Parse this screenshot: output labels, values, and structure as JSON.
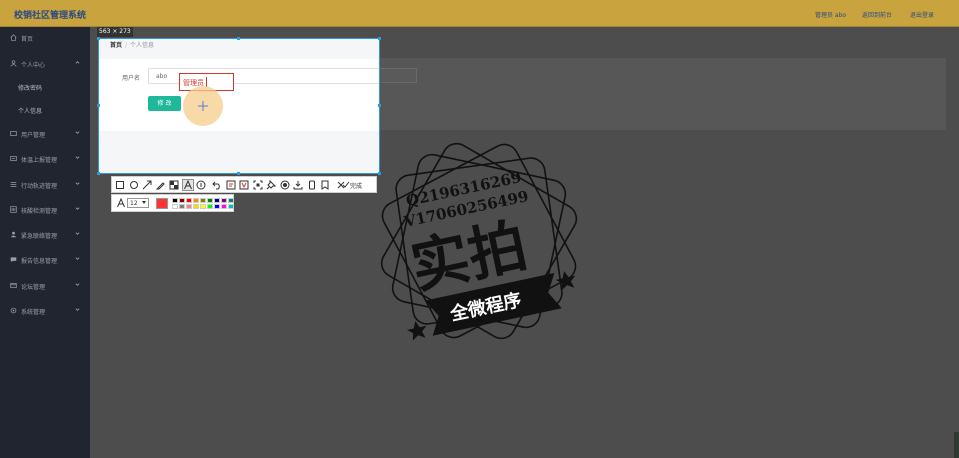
{
  "header": {
    "app_title": "校销社区管理系统",
    "links": [
      "管理员 abo",
      "返回到前台",
      "退出登录"
    ]
  },
  "sidebar": {
    "items": [
      {
        "label": "首页",
        "icon": "home-icon"
      },
      {
        "label": "个人中心",
        "icon": "user-icon"
      },
      {
        "label": "用户管理",
        "icon": "users-icon"
      },
      {
        "label": "体温上报管理",
        "icon": "temperature-icon"
      },
      {
        "label": "行动轨迹管理",
        "icon": "track-icon"
      },
      {
        "label": "核酸检测管理",
        "icon": "test-icon"
      },
      {
        "label": "紧急联络管理",
        "icon": "contact-icon"
      },
      {
        "label": "报告信息管理",
        "icon": "report-icon"
      },
      {
        "label": "论坛管理",
        "icon": "forum-icon"
      },
      {
        "label": "系统管理",
        "icon": "settings-icon"
      }
    ],
    "subitems": [
      "修改密码",
      "个人信息"
    ]
  },
  "capture": {
    "size_label": "563 × 273",
    "breadcrumb": {
      "home": "首页",
      "separator": "/",
      "current": "个人信息"
    },
    "form": {
      "username_label": "用户名",
      "username_value": "abo",
      "submit_label": "修 改"
    },
    "annotation_text": "管理员"
  },
  "toolbar": {
    "tools": [
      "rectangle-icon",
      "ellipse-icon",
      "arrow-icon",
      "pen-icon",
      "mosaic-icon",
      "text-icon",
      "number-icon",
      "undo-icon",
      "ocr-icon",
      "translate-icon",
      "long-screenshot-icon",
      "pin-icon",
      "record-icon",
      "save-icon",
      "phone-icon",
      "bookmark-icon",
      "cancel-icon"
    ],
    "active_tool": "text-icon",
    "done_label": "完成",
    "font_size": "12",
    "current_color": "#ff3333",
    "palette": [
      [
        "#000000",
        "#7f0000",
        "#ff0000",
        "#ff8c00",
        "#7f7f00",
        "#007f00",
        "#00007f",
        "#7f007f",
        "#007f7f"
      ],
      [
        "#ffffff",
        "#7f7f7f",
        "#ff7f7f",
        "#ffd700",
        "#ffff00",
        "#00ff00",
        "#0000ff",
        "#ff00ff",
        "#00bfbf"
      ]
    ]
  },
  "watermark": {
    "line1": "Q2196316269",
    "line2": "V17060256499",
    "big": "实拍",
    "banner": "全微程序"
  }
}
